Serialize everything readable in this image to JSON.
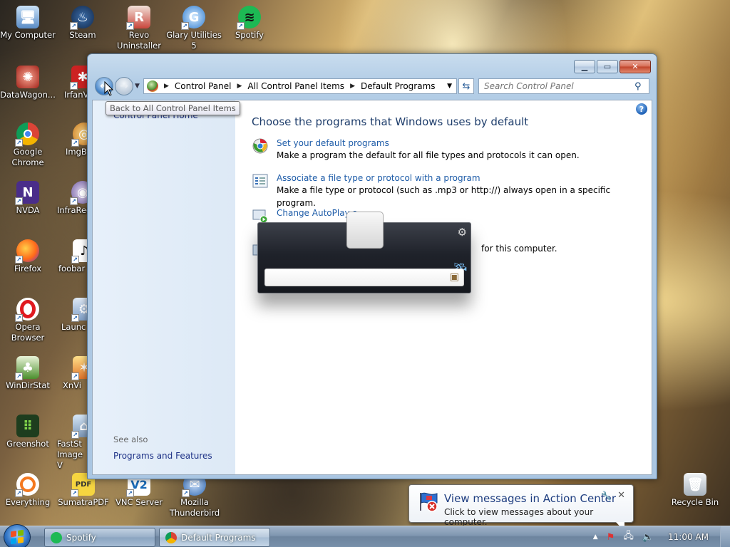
{
  "desktop": {
    "icons": [
      {
        "label": "My Computer",
        "icon": "computer-icon"
      },
      {
        "label": "Steam",
        "icon": "steam-icon"
      },
      {
        "label": "Revo Uninstaller",
        "icon": "revo-icon"
      },
      {
        "label": "Glary Utilities 5",
        "icon": "glary-icon"
      },
      {
        "label": "Spotify",
        "icon": "spotify-icon"
      },
      {
        "label": "DataWagon...",
        "icon": "datawagon-icon"
      },
      {
        "label": "IrfanV",
        "icon": "irfanview-icon"
      },
      {
        "label": "Google Chrome",
        "icon": "chrome-icon"
      },
      {
        "label": "ImgB",
        "icon": "imgburn-icon"
      },
      {
        "label": "NVDA",
        "icon": "nvda-icon"
      },
      {
        "label": "InfraRec",
        "icon": "infrarecorder-icon"
      },
      {
        "label": "Firefox",
        "icon": "firefox-icon"
      },
      {
        "label": "foobar",
        "icon": "foobar-icon"
      },
      {
        "label": "Opera Browser",
        "icon": "opera-icon"
      },
      {
        "label": "Launc",
        "icon": "launcher-icon"
      },
      {
        "label": "WinDirStat",
        "icon": "windirstat-icon"
      },
      {
        "label": "XnVi",
        "icon": "xnview-icon"
      },
      {
        "label": "Greenshot",
        "icon": "greenshot-icon"
      },
      {
        "label": "FastSt Image V",
        "icon": "faststone-icon"
      },
      {
        "label": "Everything",
        "icon": "everything-icon"
      },
      {
        "label": "SumatraPDF",
        "icon": "sumatra-icon"
      },
      {
        "label": "VNC Server",
        "icon": "vnc-icon"
      },
      {
        "label": "Mozilla Thunderbird",
        "icon": "thunderbird-icon"
      },
      {
        "label": "Recycle Bin",
        "icon": "recycle-bin-icon"
      }
    ]
  },
  "window": {
    "address": {
      "crumbs": [
        "Control Panel",
        "All Control Panel Items",
        "Default Programs"
      ]
    },
    "search_placeholder": "Search Control Panel",
    "left": {
      "home": "Control Panel Home",
      "see_also": "See also",
      "programs_features": "Programs and Features"
    },
    "title": "Choose the programs that Windows uses by default",
    "tasks": [
      {
        "link": "Set your default programs",
        "desc": "Make a program the default for all file types and protocols it can open."
      },
      {
        "link": "Associate a file type or protocol with a program",
        "desc": "Make a file type or protocol (such as .mp3 or http://) always open in a specific program."
      },
      {
        "link": "Change AutoPlay s",
        "desc": ""
      },
      {
        "link": "",
        "desc": "for this computer."
      }
    ]
  },
  "tooltip": "Back to All Control Panel Items",
  "balloon": {
    "title": "View messages in Action Center",
    "text": "Click to view messages about your computer."
  },
  "taskbar": {
    "buttons": [
      {
        "label": "Spotify",
        "icon": "spotify-icon"
      },
      {
        "label": "Default Programs",
        "icon": "control-panel-icon"
      }
    ],
    "clock": "11:00 AM"
  },
  "colors": {
    "link": "#1e5ca8",
    "title": "#1e3d6b",
    "leftpane_link": "#1e3287"
  }
}
